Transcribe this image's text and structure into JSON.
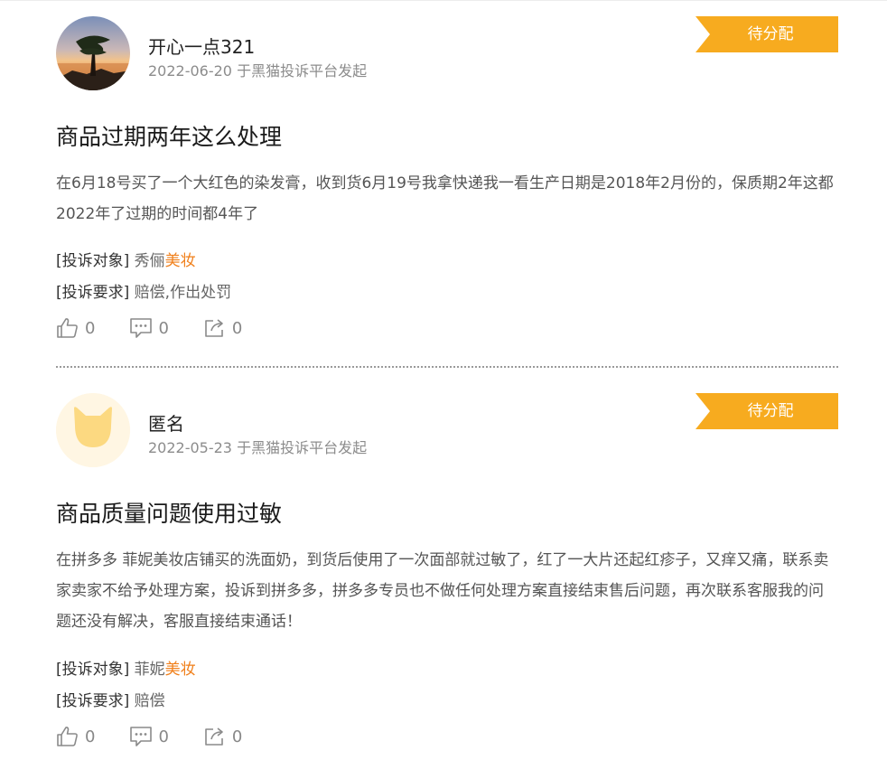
{
  "complaints": [
    {
      "user": "开心一点321",
      "date": "2022-06-20",
      "source": "于黑猫投诉平台发起",
      "status": "待分配",
      "title": "商品过期两年这么处理",
      "description": "在6月18号买了一个大红色的染发膏，收到货6月19号我拿快递我一看生产日期是2018年2月份的，保质期2年这都2022年了过期的时间都4年了",
      "target_label": "[投诉对象]",
      "target_prefix": "秀俪",
      "target_highlight": "美妆",
      "demand_label": "[投诉要求]",
      "demand": "赔偿,作出处罚",
      "likes": "0",
      "comments": "0",
      "shares": "0",
      "avatar_icon": "landscape-tree-photo"
    },
    {
      "user": "匿名",
      "date": "2022-05-23",
      "source": "于黑猫投诉平台发起",
      "status": "待分配",
      "title": "商品质量问题使用过敏",
      "description": "在拼多多 菲妮美妆店铺买的洗面奶，到货后使用了一次面部就过敏了，红了一大片还起红疹子，又痒又痛，联系卖家卖家不给予处理方案，投诉到拼多多，拼多多专员也不做任何处理方案直接结束售后问题，再次联系客服我的问题还没有解决，客服直接结束通话！",
      "target_label": "[投诉对象]",
      "target_prefix": "菲妮",
      "target_highlight": "美妆",
      "demand_label": "[投诉要求]",
      "demand": "赔偿",
      "likes": "0",
      "comments": "0",
      "shares": "0",
      "avatar_icon": "cat-face-icon"
    }
  ],
  "colors": {
    "status_bg": "#f7ab1f",
    "highlight": "#f07f1a",
    "muted": "#8c8c8c"
  }
}
